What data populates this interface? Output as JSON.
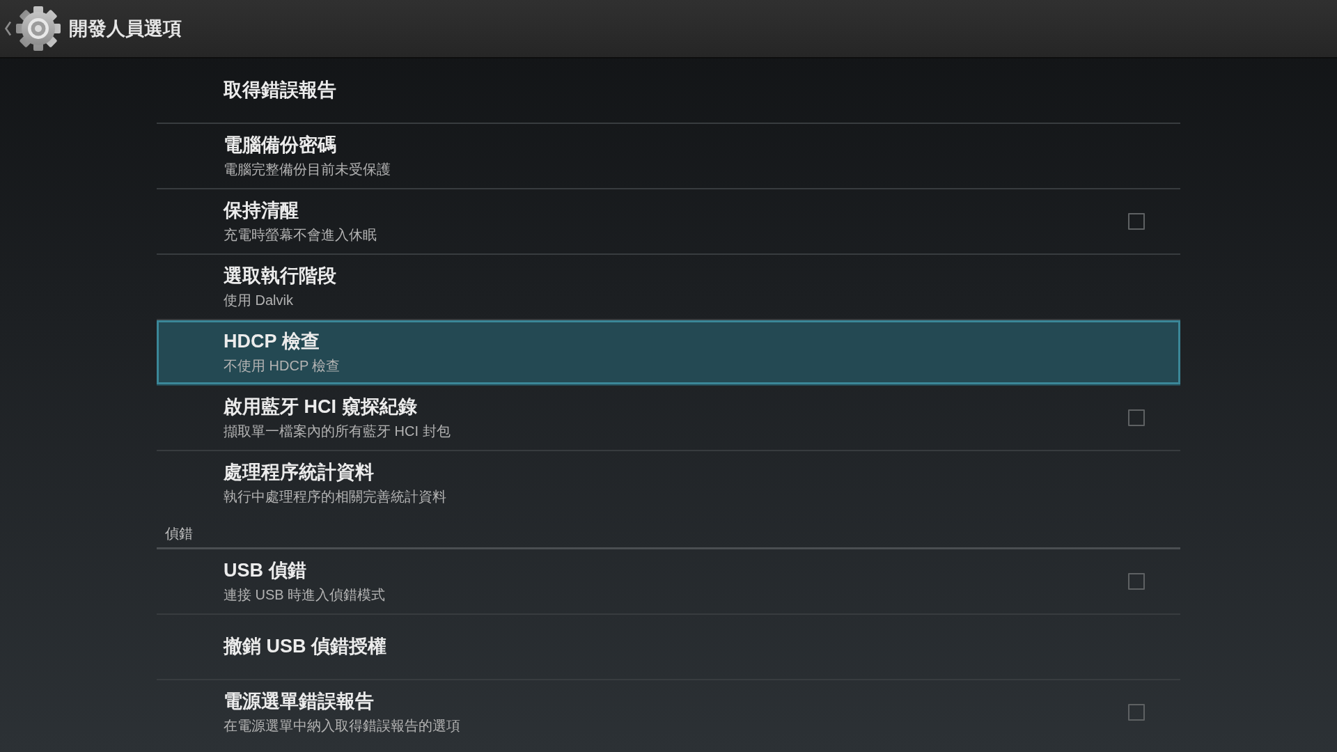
{
  "action_bar": {
    "title": "開發人員選項"
  },
  "sections": [
    {
      "items": [
        {
          "kind": "plain",
          "title": "取得錯誤報告",
          "selected": false
        },
        {
          "kind": "plain",
          "title": "電腦備份密碼",
          "summary": "電腦完整備份目前未受保護",
          "selected": false
        },
        {
          "kind": "checkbox",
          "title": "保持清醒",
          "summary": "充電時螢幕不會進入休眠",
          "checked": false,
          "selected": false
        },
        {
          "kind": "plain",
          "title": "選取執行階段",
          "summary": "使用 Dalvik",
          "selected": false
        },
        {
          "kind": "plain",
          "title": "HDCP 檢查",
          "summary": "不使用 HDCP 檢查",
          "selected": true
        },
        {
          "kind": "checkbox",
          "title": "啟用藍牙 HCI 窺探紀錄",
          "summary": "擷取單一檔案內的所有藍牙 HCI 封包",
          "checked": false,
          "selected": false
        },
        {
          "kind": "plain",
          "title": "處理程序統計資料",
          "summary": "執行中處理程序的相關完善統計資料",
          "selected": false
        }
      ]
    },
    {
      "title": "偵錯",
      "items": [
        {
          "kind": "checkbox",
          "title": "USB 偵錯",
          "summary": "連接 USB 時進入偵錯模式",
          "checked": false,
          "selected": false
        },
        {
          "kind": "plain",
          "title": "撤銷 USB 偵錯授權",
          "selected": false
        },
        {
          "kind": "checkbox",
          "title": "電源選單錯誤報告",
          "summary": "在電源選單中納入取得錯誤報告的選項",
          "checked": false,
          "selected": false
        }
      ]
    }
  ]
}
